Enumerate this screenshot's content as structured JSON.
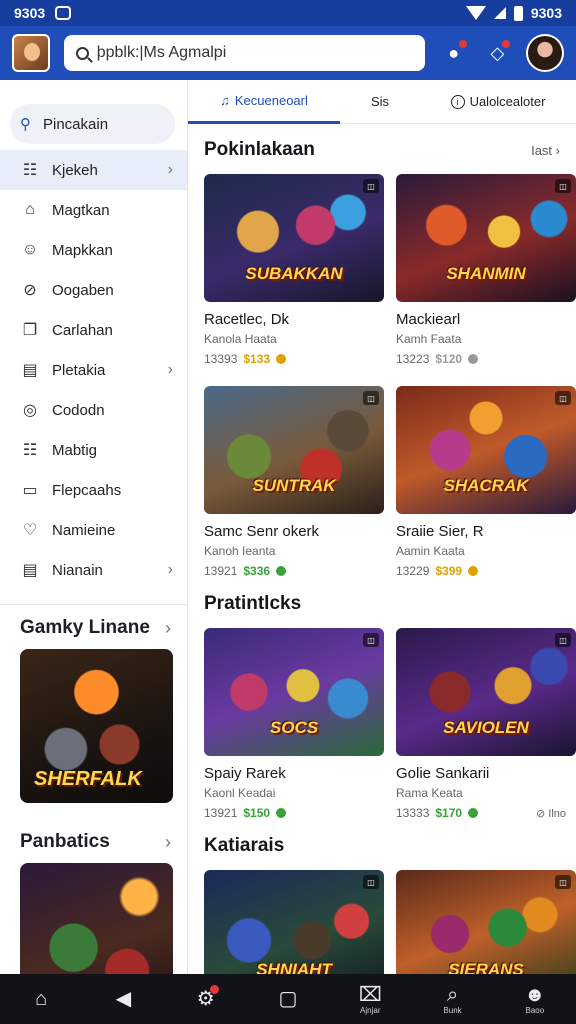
{
  "status": {
    "time": "9303"
  },
  "header": {
    "search_placeholder": "þpblk:|Ms Agmalpi",
    "search_icon": "search-icon",
    "notifications_icon": "bell-icon",
    "shield_icon": "shield-icon"
  },
  "sidebar": {
    "search_label": "Pincakain",
    "items": [
      {
        "label": "Kjekeh",
        "icon": "☷",
        "chevron": true,
        "active": true
      },
      {
        "label": "Magtkan",
        "icon": "⌂",
        "chevron": false
      },
      {
        "label": "Mapkkan",
        "icon": "☺",
        "chevron": false
      },
      {
        "label": "Oogaben",
        "icon": "⊘",
        "chevron": false
      },
      {
        "label": "Carlahan",
        "icon": "❐",
        "chevron": false
      },
      {
        "label": "Pletakia",
        "icon": "▤",
        "chevron": true
      },
      {
        "label": "Cododn",
        "icon": "◎",
        "chevron": false
      },
      {
        "label": "Mabtig",
        "icon": "☷",
        "chevron": false
      },
      {
        "label": "Flepcaahs",
        "icon": "▭",
        "chevron": false
      },
      {
        "label": "Namieine",
        "icon": "♡",
        "chevron": false
      },
      {
        "label": "Nianain",
        "icon": "▤",
        "chevron": true
      }
    ],
    "section1": {
      "title": "Gamky Linane",
      "card_caption": "SHERFALK"
    },
    "section2": {
      "title": "Panbatics"
    }
  },
  "tabs": [
    {
      "label": "Kecueneoarl"
    },
    {
      "label": "Sis"
    },
    {
      "label": "Ualolcealoter"
    }
  ],
  "sections": [
    {
      "title": "Pokinlakaan",
      "link": "Iast",
      "cards": [
        {
          "title": "Racetlec, Dk",
          "sub": "Kanola Haata",
          "meta": "13393",
          "price": "$133",
          "price_color": "#e0a000",
          "tag": "",
          "logo": "SUBAKKAN"
        },
        {
          "title": "Mackiearl",
          "sub": "Kamh Faata",
          "meta": "13223",
          "price": "$120",
          "price_color": "#999999",
          "tag": "",
          "logo": "SHANMIN"
        }
      ]
    },
    {
      "title": "",
      "link": "",
      "cards": [
        {
          "title": "Samc Senr okerk",
          "sub": "Kanoh Ieanta",
          "meta": "13921",
          "price": "$336",
          "price_color": "#3aa23a",
          "tag": "",
          "logo": "SUNTRAK"
        },
        {
          "title": "Sraiie Sier, R",
          "sub": "Aamin Kaata",
          "meta": "13229",
          "price": "$399",
          "price_color": "#e0a000",
          "tag": "",
          "logo": "SHACRAK"
        }
      ]
    },
    {
      "title": "Pratintlcks",
      "link": "",
      "cards": [
        {
          "title": "Spaiy Rarek",
          "sub": "Kaonl Keadai",
          "meta": "13921",
          "price": "$150",
          "price_color": "#3aa23a",
          "tag": "",
          "logo": "SOCS"
        },
        {
          "title": "Golie Sankarii",
          "sub": "Rama Keata",
          "meta": "13333",
          "price": "$170",
          "price_color": "#3aa23a",
          "tag": "⊘ Ilno",
          "logo": "SAVIOLEN"
        }
      ]
    },
    {
      "title": "Katiarais",
      "link": "",
      "cards": [
        {
          "title": "",
          "sub": "",
          "meta": "",
          "price": "",
          "price_color": "#999999",
          "tag": "",
          "logo": "SHNIAHT"
        },
        {
          "title": "",
          "sub": "",
          "meta": "",
          "price": "",
          "price_color": "#999999",
          "tag": "",
          "logo": "SIERANS"
        }
      ]
    }
  ],
  "bottom_nav": [
    {
      "icon": "⌂",
      "label": ""
    },
    {
      "icon": "◀",
      "label": ""
    },
    {
      "icon": "⚙",
      "label": "",
      "dot": true
    },
    {
      "icon": "▢",
      "label": ""
    },
    {
      "icon": "⌧",
      "label": "Ajnjar"
    },
    {
      "icon": "⌕",
      "label": "Bunk"
    },
    {
      "icon": "☻",
      "label": "Baoo"
    }
  ],
  "colors": {
    "primary": "#1f4eb8",
    "status_bar": "#173e9f",
    "nav_bg": "#111318"
  }
}
